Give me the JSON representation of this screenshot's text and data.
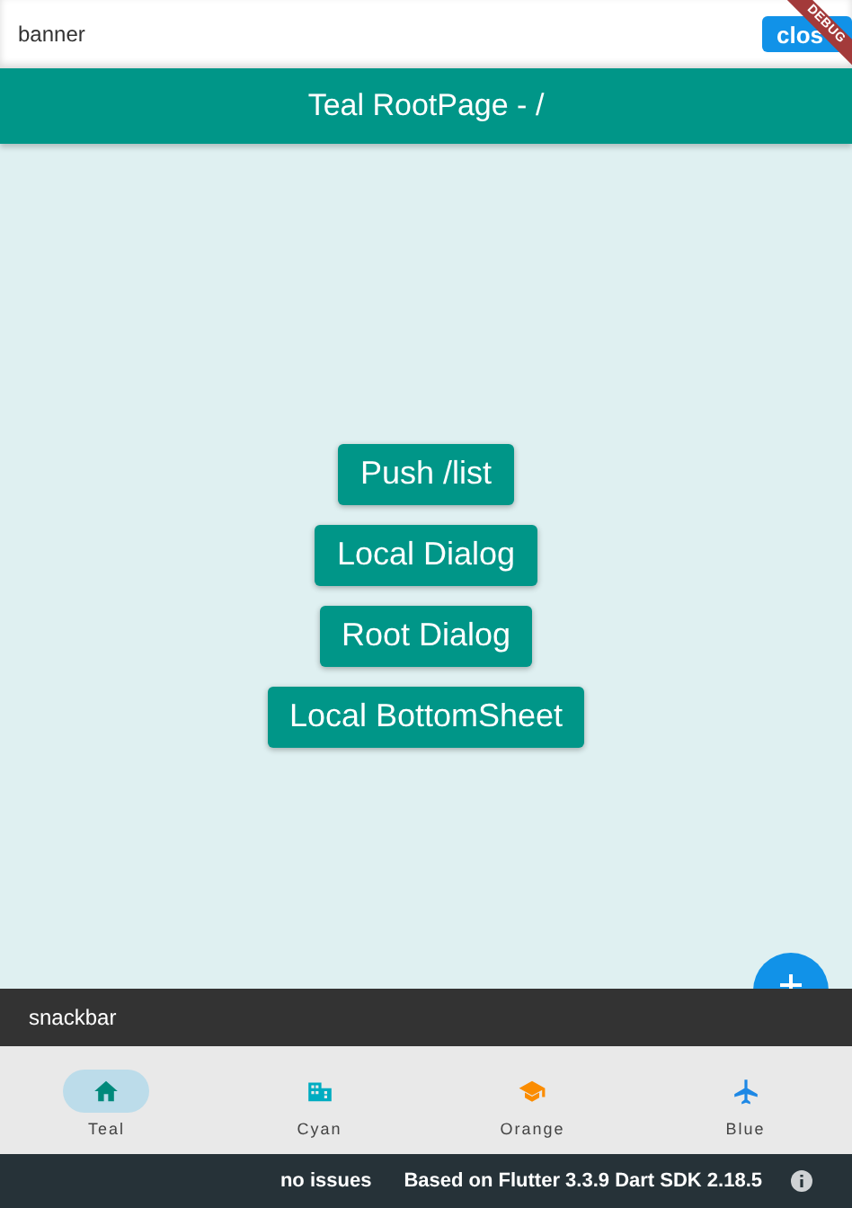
{
  "banner": {
    "text": "banner",
    "button": "clos"
  },
  "debug_ribbon": "DEBUG",
  "app_bar": {
    "title": "Teal RootPage - /"
  },
  "buttons": [
    "Push /list",
    "Local Dialog",
    "Root Dialog",
    "Local BottomSheet"
  ],
  "snackbar": {
    "text": "snackbar"
  },
  "nav": [
    {
      "label": "Teal",
      "kind": "home",
      "color": "#00897b",
      "selected": true
    },
    {
      "label": "Cyan",
      "kind": "building",
      "color": "#00acc1",
      "selected": false
    },
    {
      "label": "Orange",
      "kind": "school",
      "color": "#fb8c00",
      "selected": false
    },
    {
      "label": "Blue",
      "kind": "plane",
      "color": "#1e88e5",
      "selected": false
    }
  ],
  "status_bar": {
    "issues": "no issues",
    "version": "Based on Flutter 3.3.9 Dart SDK 2.18.5"
  }
}
